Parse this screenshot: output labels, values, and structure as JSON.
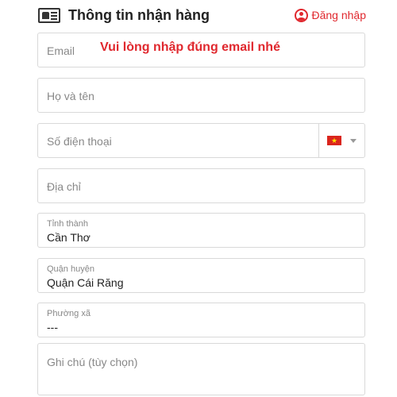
{
  "header": {
    "title": "Thông tin nhận hàng",
    "login_label": "Đăng nhập"
  },
  "form": {
    "email": {
      "placeholder": "Email",
      "error": "Vui lòng nhập đúng email nhé"
    },
    "fullname": {
      "placeholder": "Họ và tên"
    },
    "phone": {
      "placeholder": "Số điện thoại",
      "country_flag": "vietnam-flag-icon"
    },
    "address": {
      "placeholder": "Địa chỉ"
    },
    "province": {
      "label": "Tỉnh thành",
      "value": "Cần Thơ"
    },
    "district": {
      "label": "Quận huyện",
      "value": "Quận Cái Răng"
    },
    "ward": {
      "label": "Phường xã",
      "value": "---"
    },
    "note": {
      "placeholder": "Ghi chú (tùy chọn)"
    }
  },
  "colors": {
    "accent": "#e0282e",
    "border": "#d9d9d9"
  }
}
